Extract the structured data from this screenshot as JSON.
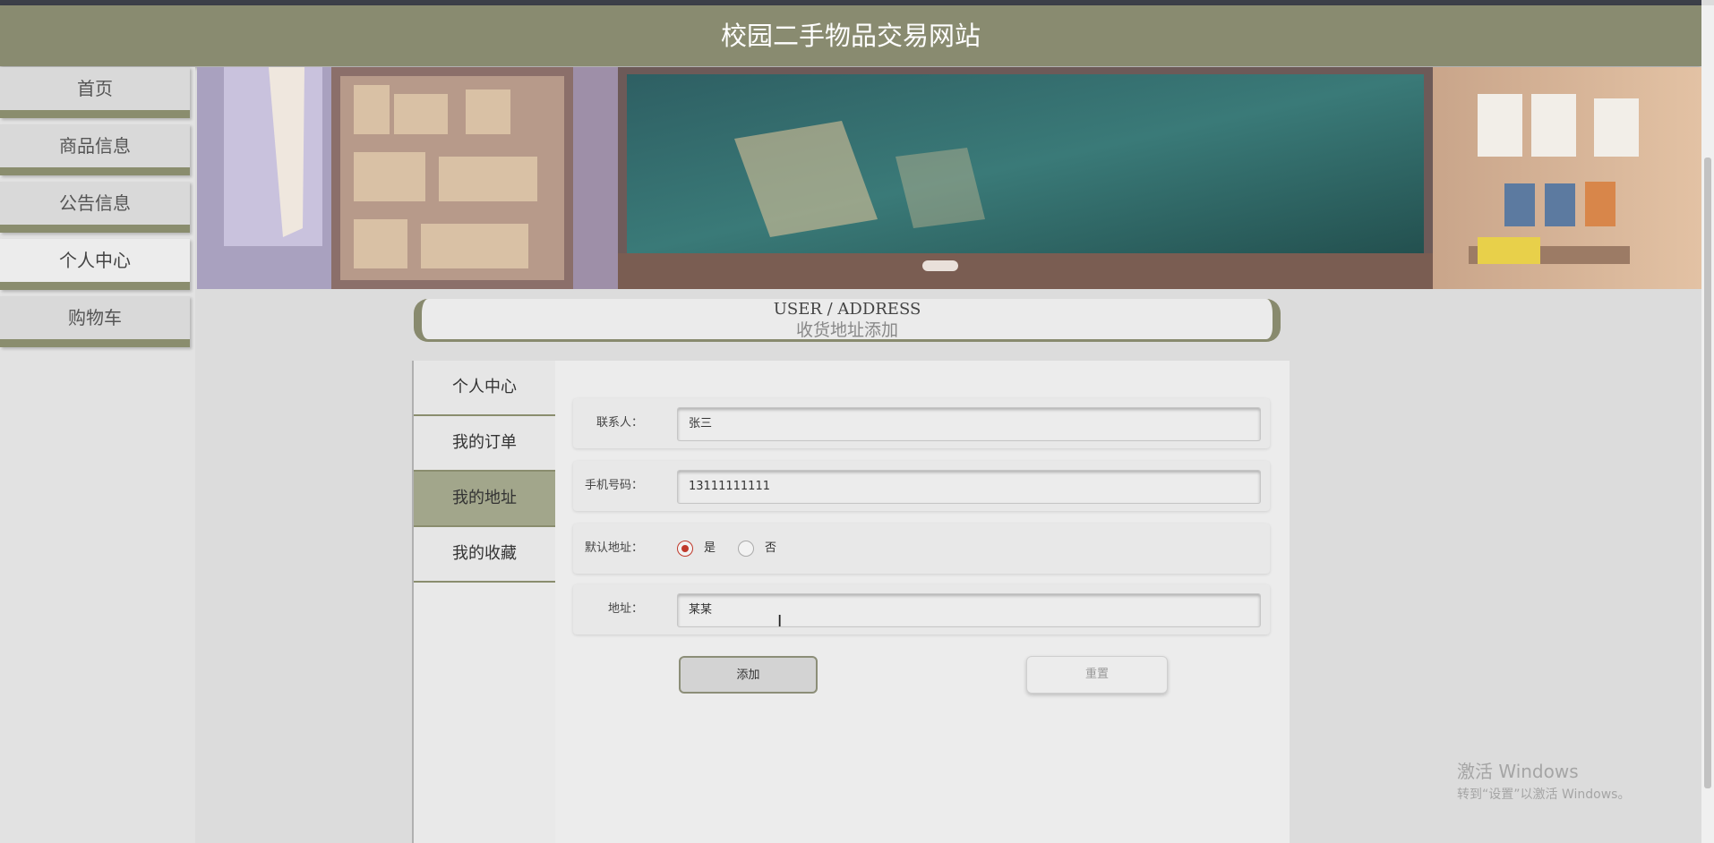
{
  "site": {
    "title": "校园二手物品交易网站"
  },
  "nav": {
    "items": [
      {
        "label": "首页"
      },
      {
        "label": "商品信息"
      },
      {
        "label": "公告信息"
      },
      {
        "label": "个人中心"
      },
      {
        "label": "购物车"
      }
    ],
    "active": "个人中心"
  },
  "page_title": {
    "en": "USER / ADDRESS",
    "cn": "收货地址添加"
  },
  "subnav": {
    "items": [
      {
        "label": "个人中心"
      },
      {
        "label": "我的订单"
      },
      {
        "label": "我的地址"
      },
      {
        "label": "我的收藏"
      }
    ],
    "active": "我的地址"
  },
  "form": {
    "contact": {
      "label": "联系人：",
      "value": "张三"
    },
    "phone": {
      "label": "手机号码：",
      "value": "13111111111"
    },
    "default_address": {
      "label": "默认地址：",
      "options": [
        "是",
        "否"
      ],
      "selected": "是"
    },
    "address": {
      "label": "地址：",
      "value": "某某"
    },
    "add_button": "添加",
    "reset_button": "重置"
  },
  "watermark": {
    "line1": "激活 Windows",
    "line2": "转到“设置”以激活 Windows。"
  },
  "colors": {
    "accent": "#898b70",
    "radio_checked": "#c0392b"
  }
}
